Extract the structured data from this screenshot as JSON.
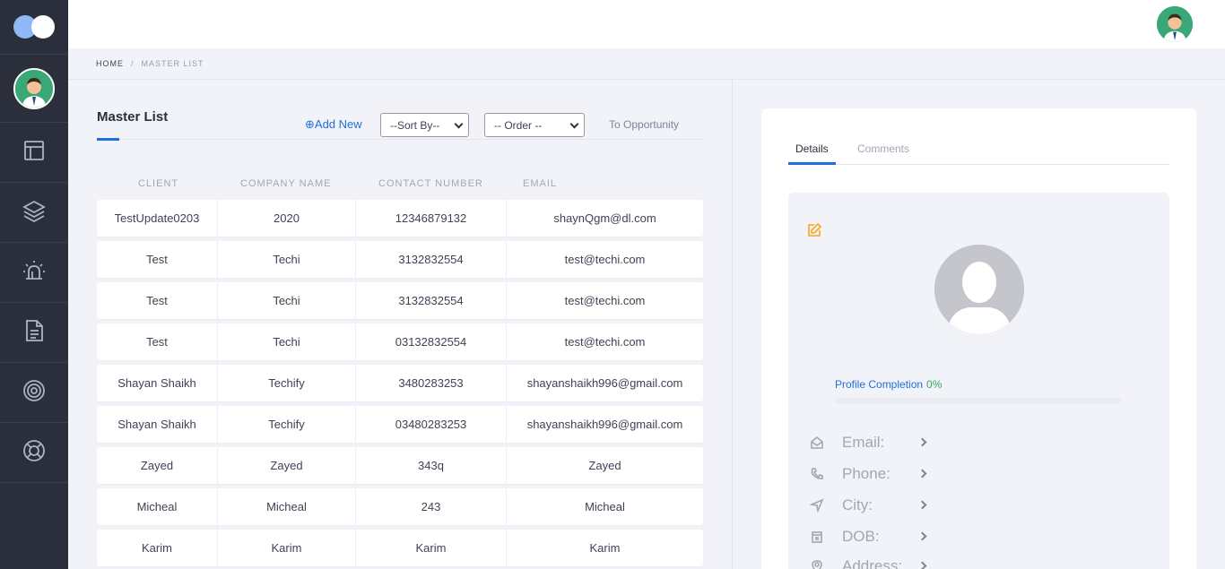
{
  "breadcrumb": {
    "home": "HOME",
    "separator": "/",
    "current": "MASTER LIST"
  },
  "sidebar": {
    "items": [
      {
        "icon": "layout-icon"
      },
      {
        "icon": "layers-icon"
      },
      {
        "icon": "alarm-icon"
      },
      {
        "icon": "document-icon"
      },
      {
        "icon": "target-icon"
      },
      {
        "icon": "lifebuoy-icon"
      }
    ]
  },
  "list": {
    "title": "Master List",
    "add_new": "⊕Add New",
    "sort_by": "--Sort By--",
    "order": "-- Order --",
    "to_opportunity": "To Opportunity",
    "columns": [
      "CLIENT",
      "COMPANY NAME",
      "CONTACT NUMBER",
      "EMAIL"
    ],
    "rows": [
      [
        "TestUpdate0203",
        "2020",
        "12346879132",
        "shaynQgm@dl.com"
      ],
      [
        "Test",
        "Techi",
        "3132832554",
        "test@techi.com"
      ],
      [
        "Test",
        "Techi",
        "3132832554",
        "test@techi.com"
      ],
      [
        "Test",
        "Techi",
        "03132832554",
        "test@techi.com"
      ],
      [
        "Shayan Shaikh",
        "Techify",
        "3480283253",
        "shayanshaikh996@gmail.com"
      ],
      [
        "Shayan Shaikh",
        "Techify",
        "03480283253",
        "shayanshaikh996@gmail.com"
      ],
      [
        "Zayed",
        "Zayed",
        "343q",
        "Zayed"
      ],
      [
        "Micheal",
        "Micheal",
        "243",
        "Micheal"
      ],
      [
        "Karim",
        "Karim",
        "Karim",
        "Karim"
      ]
    ]
  },
  "details": {
    "tabs": [
      "Details",
      "Comments"
    ],
    "profile_completion_label": "Profile Completion",
    "profile_completion_value": "0%",
    "progress": 0,
    "fields": [
      "Email:",
      "Phone:",
      "City:",
      "DOB:",
      "Address:"
    ]
  },
  "colors": {
    "accent": "#1e6fd9",
    "sidebar": "#2b2f3c",
    "edit": "#f5a623",
    "success": "#2eab5f"
  }
}
